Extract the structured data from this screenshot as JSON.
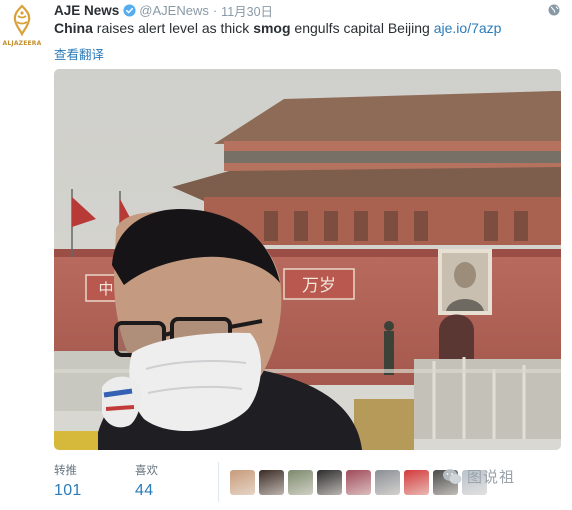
{
  "account": {
    "name": "AJE News",
    "handle": "@AJENews",
    "timestamp": "11月30日",
    "avatar_brand": "ALJAZEERA",
    "verified_icon": "verified-badge-icon"
  },
  "tweet": {
    "segments": [
      {
        "text": "China",
        "bold": true
      },
      {
        "text": " raises alert level as thick ",
        "bold": false
      },
      {
        "text": "smog",
        "bold": true
      },
      {
        "text": " engulfs capital Beijing ",
        "bold": false
      }
    ],
    "link": "aje.io/7azp",
    "translate_label": "查看翻译"
  },
  "photo": {
    "banner_left": "中",
    "banner_right": "万岁"
  },
  "stats": {
    "retweets_label": "转推",
    "retweets_count": "101",
    "favorites_label": "喜欢",
    "favorites_count": "44"
  },
  "favoriters": [
    {
      "name": "favoriter-avatar-1",
      "color": "#c79b7a"
    },
    {
      "name": "favoriter-avatar-2",
      "color": "#3a2a24"
    },
    {
      "name": "favoriter-avatar-3",
      "color": "#7c8a6e"
    },
    {
      "name": "favoriter-avatar-4",
      "color": "#2c2c2c"
    },
    {
      "name": "favoriter-avatar-5",
      "color": "#a04a5a"
    },
    {
      "name": "favoriter-avatar-6",
      "color": "#8a8f96"
    },
    {
      "name": "favoriter-avatar-7",
      "color": "#d23a3a"
    },
    {
      "name": "favoriter-avatar-8",
      "color": "#4a4a4a"
    },
    {
      "name": "favoriter-avatar-9",
      "color": "#b9c2cc"
    }
  ],
  "watermark": {
    "text": "图说祖"
  },
  "colors": {
    "link": "#2b7bb9",
    "muted": "#8899a6",
    "text": "#292f33",
    "brand_gold": "#c4902e",
    "verified": "#55acee"
  }
}
